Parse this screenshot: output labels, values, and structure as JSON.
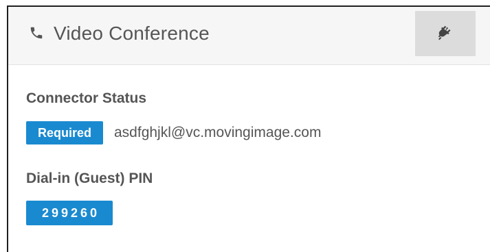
{
  "header": {
    "title": "Video Conference",
    "icon": "phone-icon",
    "action_icon": "plug-icon"
  },
  "connector": {
    "label": "Connector Status",
    "status_badge": "Required",
    "address": "asdfghjkl@vc.movingimage.com"
  },
  "pin": {
    "label": "Dial-in (Guest) PIN",
    "value": "299260"
  },
  "colors": {
    "badge_background": "#1a8ad0",
    "header_background": "#f6f6f6",
    "button_background": "#dcdcdc",
    "text": "#555555"
  }
}
